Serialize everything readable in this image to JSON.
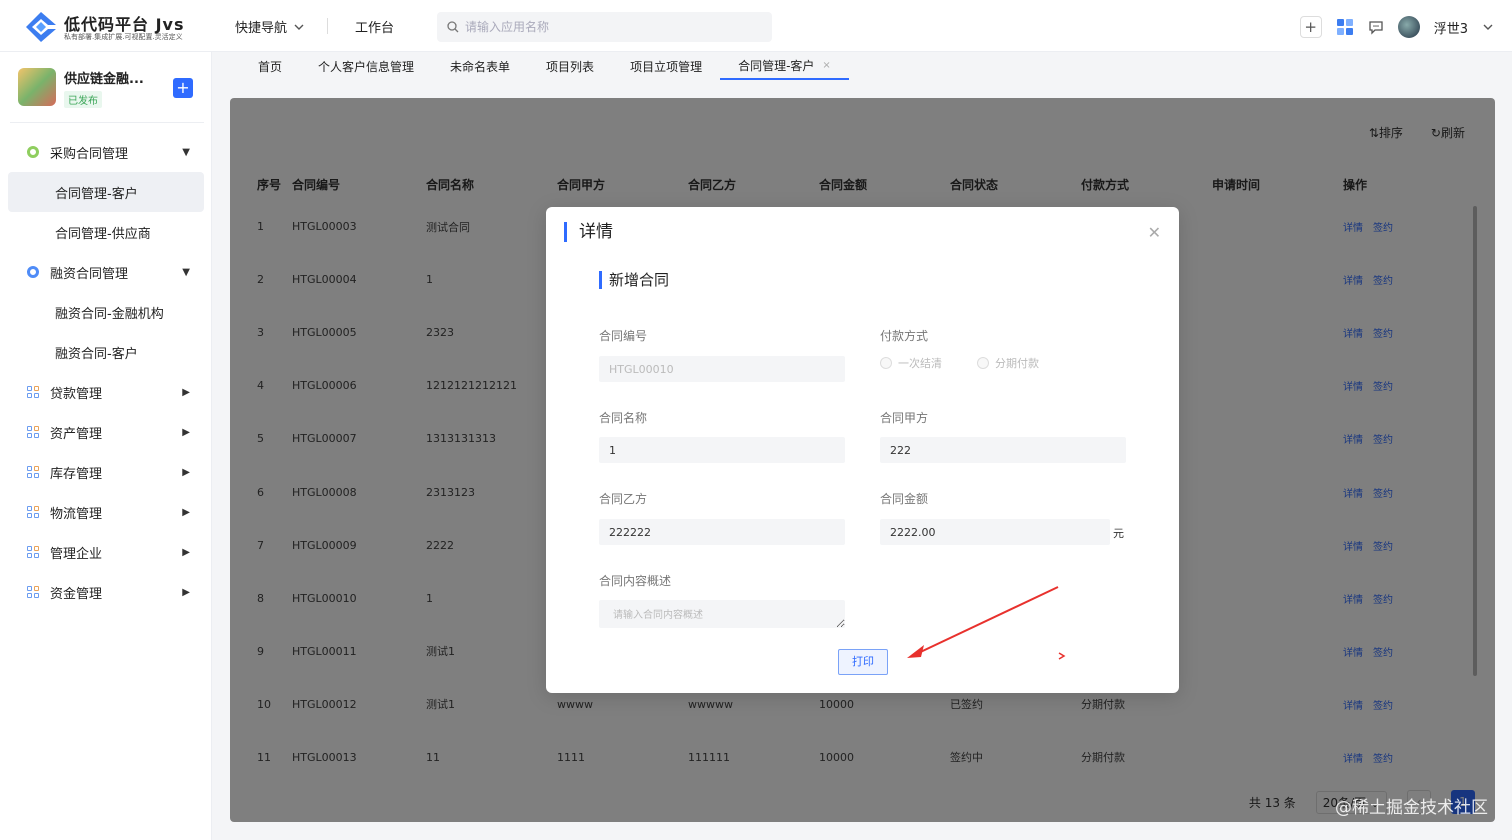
{
  "header": {
    "logo_title": "低代码平台 Jvs",
    "logo_slogan": "私有部署.集成扩展.可视配置.灵活定义",
    "quick_nav": "快捷导航",
    "workbench": "工作台",
    "search_placeholder": "请输入应用名称",
    "username": "浮世3"
  },
  "sidebar": {
    "app_name": "供应链金融...",
    "app_status": "已发布",
    "menu": [
      {
        "label": "采购合同管理",
        "type": "group-open",
        "icon": "green-circle-icon"
      },
      {
        "label": "合同管理-客户",
        "type": "sub-active"
      },
      {
        "label": "合同管理-供应商",
        "type": "sub"
      },
      {
        "label": "融资合同管理",
        "type": "group-open",
        "icon": "blue-circle-icon"
      },
      {
        "label": "融资合同-金融机构",
        "type": "sub"
      },
      {
        "label": "融资合同-客户",
        "type": "sub"
      },
      {
        "label": "贷款管理",
        "type": "group",
        "icon": "grid-icon"
      },
      {
        "label": "资产管理",
        "type": "group",
        "icon": "grid-icon"
      },
      {
        "label": "库存管理",
        "type": "group",
        "icon": "grid-icon"
      },
      {
        "label": "物流管理",
        "type": "group",
        "icon": "grid-icon"
      },
      {
        "label": "管理企业",
        "type": "group",
        "icon": "grid-icon"
      },
      {
        "label": "资金管理",
        "type": "group",
        "icon": "grid-icon"
      }
    ]
  },
  "tabs": [
    "首页",
    "个人客户信息管理",
    "未命名表单",
    "项目列表",
    "项目立项管理",
    "合同管理-客户"
  ],
  "toolbar": {
    "sort": "排序",
    "refresh": "刷新"
  },
  "table": {
    "headers": [
      "序号",
      "合同编号",
      "合同名称",
      "合同甲方",
      "合同乙方",
      "合同金额",
      "合同状态",
      "付款方式",
      "申请时间",
      "操作"
    ],
    "rows": [
      [
        "1",
        "HTGL00003",
        "测试合同",
        "",
        "",
        "",
        "",
        "",
        ""
      ],
      [
        "2",
        "HTGL00004",
        "1",
        "",
        "",
        "",
        "",
        "",
        ""
      ],
      [
        "3",
        "HTGL00005",
        "2323",
        "",
        "",
        "",
        "",
        "",
        ""
      ],
      [
        "4",
        "HTGL00006",
        "1212121212121",
        "",
        "",
        "",
        "",
        "",
        ""
      ],
      [
        "5",
        "HTGL00007",
        "1313131313",
        "",
        "",
        "",
        "",
        "",
        ""
      ],
      [
        "6",
        "HTGL00008",
        "2313123",
        "",
        "",
        "",
        "",
        "",
        ""
      ],
      [
        "7",
        "HTGL00009",
        "2222",
        "",
        "",
        "",
        "",
        "",
        ""
      ],
      [
        "8",
        "HTGL00010",
        "1",
        "",
        "",
        "",
        "",
        "",
        ""
      ],
      [
        "9",
        "HTGL00011",
        "测试1",
        "",
        "",
        "",
        "",
        "",
        ""
      ],
      [
        "10",
        "HTGL00012",
        "测试1",
        "wwww",
        "wwwww",
        "10000",
        "已签约",
        "分期付款",
        ""
      ],
      [
        "11",
        "HTGL00013",
        "11",
        "1111",
        "111111",
        "10000",
        "签约中",
        "分期付款",
        ""
      ]
    ],
    "op_detail": "详情",
    "op_sign": "签约"
  },
  "pager": {
    "total": "共 13 条",
    "page_size": "20条/页",
    "current": "1"
  },
  "modal": {
    "title": "详情",
    "section": "新增合同",
    "labels": {
      "contract_no": "合同编号",
      "payment": "付款方式",
      "contract_name": "合同名称",
      "party_a": "合同甲方",
      "party_b": "合同乙方",
      "amount": "合同金额",
      "summary": "合同内容概述"
    },
    "values": {
      "contract_no": "HTGL00010",
      "contract_name": "1",
      "party_a": "222",
      "party_b": "222222",
      "amount": "2222.00",
      "amount_unit": "元",
      "summary_placeholder": "请输入合同内容概述"
    },
    "payment_options": [
      "一次结清",
      "分期付款"
    ],
    "print_button": "打印"
  },
  "watermark": "@稀土掘金技术社区",
  "colors": {
    "accent": "#2f6bff",
    "annotation_arrow": "#e8312d"
  }
}
